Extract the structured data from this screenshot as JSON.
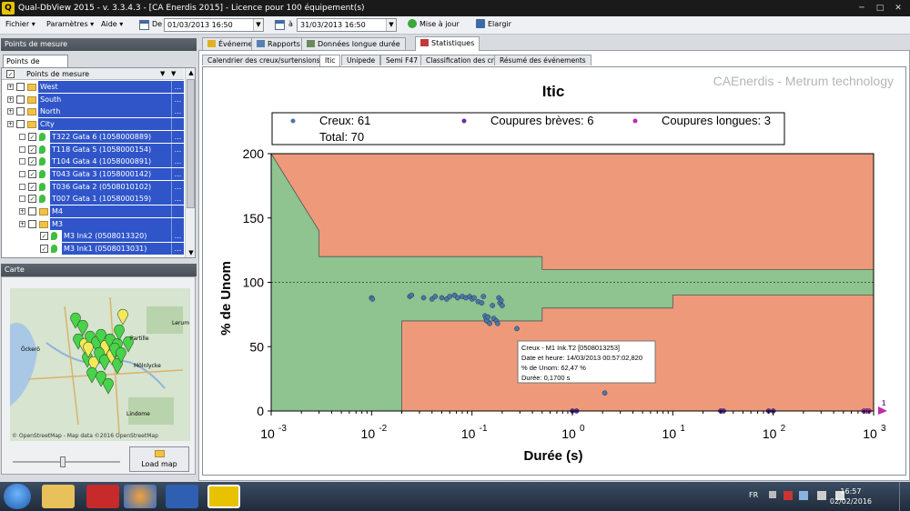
{
  "window": {
    "title": "Qual-DbView 2015 - v. 3.3.4.3 - [CA Enerdis 2015] - Licence pour 100 équipement(s)",
    "logo": "Q",
    "controls": [
      "─",
      "□",
      "✕"
    ]
  },
  "toolbar": {
    "menu": [
      "Fichier ▾",
      "Paramètres ▾",
      "Aide ▾"
    ],
    "from_label": "De",
    "from_value": "01/03/2013 16:50",
    "to_label": "à",
    "to_value": "31/03/2013 16:50",
    "refresh_label": "Mise à jour",
    "expand_label": "Elargir"
  },
  "left": {
    "points_title": "Points de mesure",
    "points_tab": "Points de mesure",
    "column_header": "Points de mesure",
    "filter_icon": "filter-icon",
    "tree": [
      {
        "label": "West",
        "type": "folder",
        "level": 0,
        "dots": "..."
      },
      {
        "label": "South",
        "type": "folder",
        "level": 0,
        "dots": "..."
      },
      {
        "label": "North",
        "type": "folder",
        "level": 0,
        "dots": "..."
      },
      {
        "label": "City",
        "type": "folder",
        "level": 0,
        "dots": ""
      },
      {
        "label": "T322 Gata 6 (1058000889)",
        "type": "device",
        "level": 1,
        "dots": "..."
      },
      {
        "label": "T118 Gata 5 (1058000154)",
        "type": "device",
        "level": 1,
        "dots": "..."
      },
      {
        "label": "T104 Gata 4 (1058000891)",
        "type": "device",
        "level": 1,
        "dots": "..."
      },
      {
        "label": "T043 Gata 3 (1058000142)",
        "type": "device",
        "level": 1,
        "dots": "..."
      },
      {
        "label": "T036 Gata 2 (0508010102)",
        "type": "device",
        "level": 1,
        "dots": "..."
      },
      {
        "label": "T007 Gata 1 (1058000159)",
        "type": "device",
        "level": 1,
        "dots": "..."
      },
      {
        "label": "M4",
        "type": "folder",
        "level": 1,
        "dots": ""
      },
      {
        "label": "M3",
        "type": "folder",
        "level": 1,
        "dots": ""
      },
      {
        "label": "M3 Ink2 (0508013320)",
        "type": "device",
        "level": 2,
        "dots": "..."
      },
      {
        "label": "M3 Ink1 (0508013031)",
        "type": "device",
        "level": 2,
        "dots": "..."
      }
    ],
    "map_title": "Carte",
    "map_places": [
      "Lerum",
      "Öckerö",
      "Partille",
      "Mölnlycke",
      "Lindome"
    ],
    "map_copyright": "© OpenStreetMap - Map data ©2016 OpenStreetMap",
    "load_map_label": "Load map"
  },
  "tabs": [
    {
      "label": "Événements",
      "icon": "lightning-icon",
      "active": false
    },
    {
      "label": "Rapports",
      "icon": "report-icon",
      "active": false
    },
    {
      "label": "Données longue durée",
      "icon": "trend-icon",
      "active": false
    },
    {
      "label": "Statistiques",
      "icon": "bar-chart-icon",
      "active": true
    }
  ],
  "subtabs": [
    {
      "label": "Calendrier des creux/surtensions",
      "active": false
    },
    {
      "label": "Itic",
      "active": true
    },
    {
      "label": "Unipede",
      "active": false
    },
    {
      "label": "Semi F47",
      "active": false
    },
    {
      "label": "Classification des creux",
      "active": false
    },
    {
      "label": "Résumé des événements",
      "active": false
    }
  ],
  "chart_data": {
    "type": "scatter",
    "title": "Itic",
    "watermark": "CAEnerdis - Metrum technology",
    "xlabel": "Durée (s)",
    "ylabel": "% de Unom",
    "xscale": "log",
    "xlim": [
      0.001,
      1000
    ],
    "ylim": [
      0,
      200
    ],
    "xticks_base": "10",
    "xticks_exp": [
      "-3",
      "-2",
      "-1",
      "0",
      "1",
      "2",
      "3"
    ],
    "yticks": [
      "0",
      "50",
      "100",
      "150",
      "200"
    ],
    "reference_line": 100,
    "legend": {
      "placement": "top",
      "entries": [
        {
          "label": "Creux: 61",
          "color": "#4a78a8"
        },
        {
          "label": "Coupures brèves: 6",
          "color": "#6a2da8"
        },
        {
          "label": "Coupures longues: 3",
          "color": "#c02ab0"
        }
      ],
      "total": "Total: 70"
    },
    "colors": {
      "acceptable": "#8fc38f",
      "unacceptable": "#ee9a7a"
    },
    "upper_curve": [
      [
        0.001,
        200
      ],
      [
        0.003,
        140
      ],
      [
        0.003,
        120
      ],
      [
        0.5,
        120
      ],
      [
        0.5,
        110
      ],
      [
        1000,
        110
      ]
    ],
    "lower_curve": [
      [
        0.02,
        0
      ],
      [
        0.02,
        70
      ],
      [
        0.5,
        70
      ],
      [
        0.5,
        80
      ],
      [
        10,
        80
      ],
      [
        10,
        90
      ],
      [
        1000,
        90
      ]
    ],
    "series": [
      {
        "name": "Creux",
        "color": "#4a78a8",
        "points": [
          [
            0.01,
            88
          ],
          [
            0.0102,
            87
          ],
          [
            0.024,
            89
          ],
          [
            0.025,
            90
          ],
          [
            0.033,
            88
          ],
          [
            0.04,
            87
          ],
          [
            0.043,
            89
          ],
          [
            0.05,
            88
          ],
          [
            0.056,
            87
          ],
          [
            0.06,
            89
          ],
          [
            0.067,
            90
          ],
          [
            0.072,
            88
          ],
          [
            0.08,
            89
          ],
          [
            0.087,
            88
          ],
          [
            0.095,
            89
          ],
          [
            0.1,
            87
          ],
          [
            0.105,
            88
          ],
          [
            0.115,
            85
          ],
          [
            0.125,
            84
          ],
          [
            0.13,
            89
          ],
          [
            0.135,
            74
          ],
          [
            0.138,
            72
          ],
          [
            0.14,
            70
          ],
          [
            0.145,
            73
          ],
          [
            0.15,
            68
          ],
          [
            0.16,
            82
          ],
          [
            0.165,
            72
          ],
          [
            0.175,
            70
          ],
          [
            0.18,
            68
          ],
          [
            0.185,
            88
          ],
          [
            0.19,
            84
          ],
          [
            0.195,
            86
          ],
          [
            0.2,
            82
          ],
          [
            0.28,
            64
          ],
          [
            2.1,
            14
          ]
        ]
      },
      {
        "name": "Coupures brèves",
        "color": "#6a2da8",
        "points": [
          [
            1.0,
            0
          ],
          [
            1.1,
            0
          ],
          [
            30,
            0
          ],
          [
            32,
            0
          ],
          [
            90,
            0
          ],
          [
            100,
            0
          ]
        ]
      },
      {
        "name": "Coupures longues",
        "color": "#c02ab0",
        "points": [
          [
            800,
            0
          ],
          [
            850,
            0
          ],
          [
            900,
            0
          ]
        ]
      }
    ],
    "tooltip": {
      "lines": [
        "Creux - M1 Ink.T2 [0508013253]",
        "Date et heure: 14/03/2013 00:57:02,820",
        "% de Unom: 62,47 %",
        "Durée: 0,1700 s"
      ]
    },
    "edge_marker": "1"
  },
  "taskbar": {
    "lang": "FR",
    "time": "16:57",
    "date": "02/02/2016"
  }
}
